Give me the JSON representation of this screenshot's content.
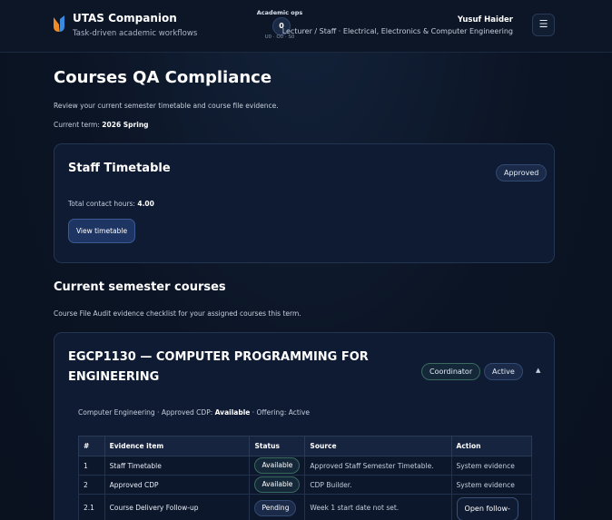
{
  "header": {
    "app_title": "UTAS Companion",
    "app_subtitle": "Task-driven academic workflows",
    "ops_label": "Academic ops",
    "ops_count": "0",
    "ops_breakdown": "U0 · O0 · S0",
    "user_name": "Yusuf Haider",
    "user_role": "Lecturer / Staff · Electrical, Electronics & Computer Engineering",
    "menu_icon": "☰"
  },
  "page": {
    "title": "Courses QA Compliance",
    "description": "Review your current semester timetable and course file evidence.",
    "term_label": "Current term:",
    "term_value": "2026 Spring"
  },
  "timetable_card": {
    "title": "Staff Timetable",
    "status_badge": "Approved",
    "hours_label": "Total contact hours:",
    "hours_value": "4.00",
    "view_button": "View timetable"
  },
  "courses_section": {
    "title": "Current semester courses",
    "description": "Course File Audit evidence checklist for your assigned courses this term."
  },
  "course": {
    "title": "EGCP1130 — COMPUTER PROGRAMMING FOR ENGINEERING",
    "role_badge": "Coordinator",
    "state_badge": "Active",
    "chevron": "▲",
    "meta_prefix": "Computer Engineering · Approved CDP:",
    "meta_cdp": "Available",
    "meta_suffix": "· Offering: Active",
    "table": {
      "headers": [
        "#",
        "Evidence item",
        "Status",
        "Source",
        "Action"
      ],
      "rows": [
        {
          "num": "1",
          "item": "Staff Timetable",
          "status": "Available",
          "source": "Approved Staff Semester Timetable.",
          "action": "System evidence"
        },
        {
          "num": "2",
          "item": "Approved CDP",
          "status": "Available",
          "source": "CDP Builder.",
          "action": "System evidence"
        },
        {
          "num": "2.1",
          "item": "Course Delivery Follow-up",
          "status": "Pending",
          "source": "Week 1 start date not set.",
          "action": "Open follow-"
        }
      ]
    }
  },
  "colors": {
    "background": "#0b1424",
    "card": "#0f1b33",
    "accent_blue": "#1e3563",
    "logo_orange": "#f08a24",
    "logo_blue": "#3a8be0"
  }
}
